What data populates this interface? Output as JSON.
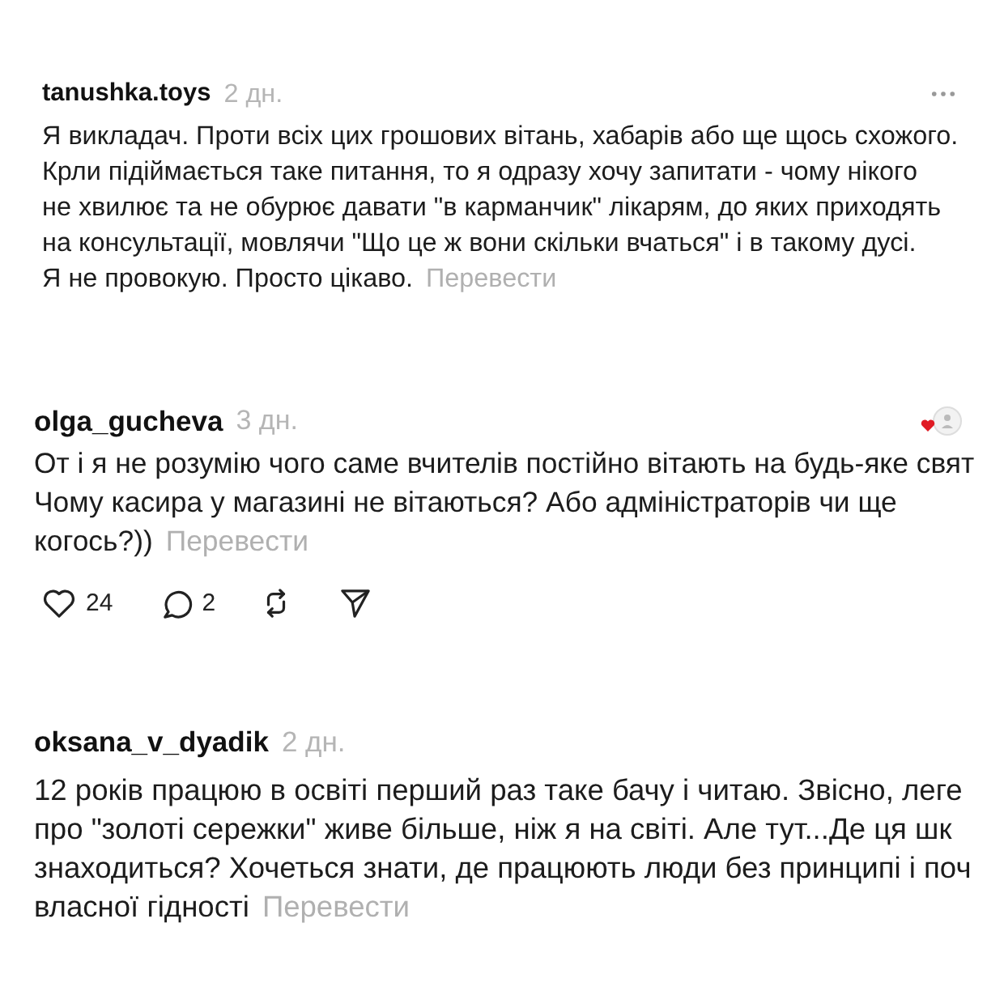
{
  "comments": [
    {
      "username": "tanushka.toys",
      "time": "2 дн.",
      "has_menu": true,
      "lines": [
        "Я викладач. Проти всіх цих грошових вітань, хабарів або ще щось схожого.",
        "Крли підіймається таке питання, то я одразу хочу запитати - чому нікого",
        "не хвилює та не обурює давати \"в карманчик\" лікарям, до яких приходять",
        "на консультації, мовлячи \"Що це ж вони скільки вчаться\" і в такому дусі.",
        "Я не провокую. Просто цікаво."
      ],
      "translate": "Перевести"
    },
    {
      "username": "olga_gucheva",
      "time": "3 дн.",
      "author_liked": true,
      "lines": [
        "От і я не розумію чого саме вчителів постійно вітають на будь-яке свят",
        "Чому касира у магазині не вітаються? Або адміністраторів чи ще",
        "когось?))"
      ],
      "translate": "Перевести",
      "actions": {
        "likes": "24",
        "replies": "2"
      }
    },
    {
      "username": "oksana_v_dyadik",
      "time": "2 дн.",
      "lines": [
        "12 років працюю в освіті перший раз таке бачу і читаю. Звісно, леге",
        "про \"золоті сережки\" живе більше, ніж я на світі. Але тут...Де ця шк",
        "знаходиться? Хочеться знати, де працюють люди без принципі і поч",
        "власної гідності"
      ],
      "translate": "Перевести"
    }
  ]
}
